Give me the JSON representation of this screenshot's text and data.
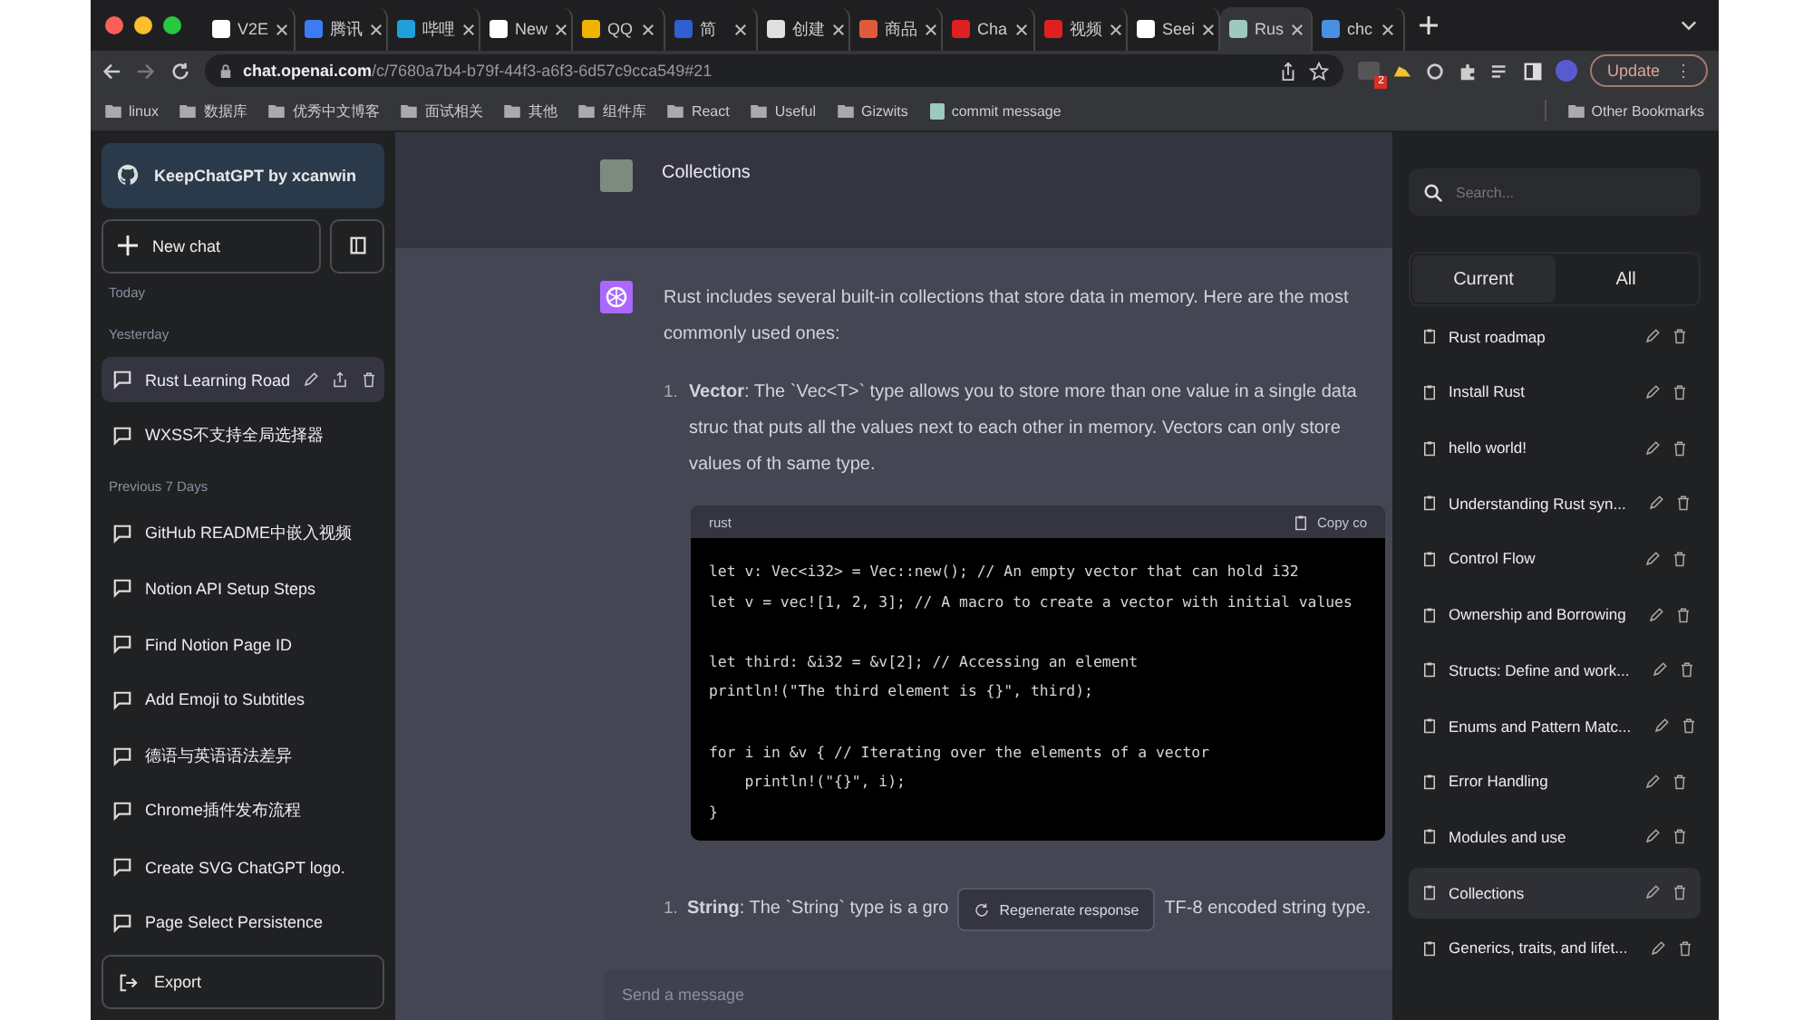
{
  "browser": {
    "tabs": [
      {
        "title": "V2E",
        "color": "#ffffff",
        "selected": false
      },
      {
        "title": "腾讯",
        "color": "#3b7cf5",
        "selected": false
      },
      {
        "title": "哔哩",
        "color": "#20a0d8",
        "selected": false
      },
      {
        "title": "New",
        "color": "#ffffff",
        "selected": false
      },
      {
        "title": "QQ",
        "color": "#f0b400",
        "selected": false
      },
      {
        "title": "简",
        "color": "#2f5fd0",
        "selected": false
      },
      {
        "title": "创建",
        "color": "#e0e0e0",
        "selected": false
      },
      {
        "title": "商品",
        "color": "#e05a3a",
        "selected": false
      },
      {
        "title": "Cha",
        "color": "#e02020",
        "selected": false
      },
      {
        "title": "视频",
        "color": "#e02020",
        "selected": false
      },
      {
        "title": "Seei",
        "color": "#ffffff",
        "selected": false
      },
      {
        "title": "Rus",
        "color": "#9fc9bc",
        "selected": true
      },
      {
        "title": "chc",
        "color": "#4a90e2",
        "selected": false
      }
    ],
    "url_host": "chat.openai.com",
    "url_path": "/c/7680a7b4-b79f-44f3-a6f3-6d57c9cca549#21",
    "extension_badge": "2",
    "update_button": "Update",
    "menu_glyph": "⋮",
    "bookmarks": [
      "linux",
      "数据库",
      "优秀中文博客",
      "面试相关",
      "其他",
      "组件库",
      "React",
      "Useful",
      "Gizwits"
    ],
    "bookmark_page": "commit message",
    "other_bookmarks": "Other Bookmarks"
  },
  "sidebar": {
    "banner": "KeepChatGPT by xcanwin",
    "new_chat": "New chat",
    "groups": [
      {
        "label": "Today"
      },
      {
        "label": "Yesterday",
        "items": [
          {
            "title": "Rust Learning Road",
            "selected": true
          },
          {
            "title": "WXSS不支持全局选择器",
            "selected": false
          }
        ]
      },
      {
        "label": "Previous 7 Days",
        "items": [
          {
            "title": "GitHub README中嵌入视频",
            "selected": false
          },
          {
            "title": "Notion API Setup Steps",
            "selected": false
          },
          {
            "title": "Find Notion Page ID",
            "selected": false
          },
          {
            "title": "Add Emoji to Subtitles",
            "selected": false
          },
          {
            "title": "德语与英语语法差异",
            "selected": false
          },
          {
            "title": "Chrome插件发布流程",
            "selected": false
          },
          {
            "title": "Create SVG ChatGPT logo.",
            "selected": false
          },
          {
            "title": "Page Select Persistence",
            "selected": false
          }
        ]
      }
    ],
    "export": "Export"
  },
  "chat": {
    "user_message": "Collections",
    "intro": "Rust includes several built-in collections that store data in memory. Here are the most commonly used ones:",
    "item_number": "1.",
    "item_text": "**Vector**: The `Vec<T>` type allows you to store more than one value in a single data struc that puts all the values next to each other in memory. Vectors can only store values of th same type.",
    "code": {
      "language": "rust",
      "copy": "Copy co",
      "blocks": [
        [
          "let v: Vec<i32> = Vec::new(); // An empty vector that can hold i32",
          "let v = vec![1, 2, 3]; // A macro to create a vector with initial values"
        ],
        [
          "let third: &i32 = &v[2]; // Accessing an element",
          "println!(\"The third element is {}\", third);"
        ],
        [
          "for i in &v { // Iterating over the elements of a vector",
          "    println!(\"{}\", i);",
          "}"
        ]
      ]
    },
    "item2_number": "1.",
    "item2_start": "**String**: The `String` type is a gro",
    "item2_end": "TF-8 encoded string type.",
    "regenerate": "Regenerate response",
    "input": {
      "placeholder": "Send a message"
    }
  },
  "panel": {
    "search": {
      "placeholder": "Search..."
    },
    "tabs": [
      {
        "label": "Current",
        "selected": true
      },
      {
        "label": "All",
        "selected": false
      }
    ],
    "items": [
      {
        "title": "Rust roadmap",
        "selected": false
      },
      {
        "title": "Install Rust",
        "selected": false
      },
      {
        "title": "hello world!",
        "selected": false
      },
      {
        "title": "Understanding Rust syn...",
        "selected": false
      },
      {
        "title": "Control Flow",
        "selected": false
      },
      {
        "title": "Ownership and Borrowing",
        "selected": false
      },
      {
        "title": "Structs: Define and work...",
        "selected": false
      },
      {
        "title": "Enums and Pattern Matc...",
        "selected": false
      },
      {
        "title": "Error Handling",
        "selected": false
      },
      {
        "title": "Modules and use",
        "selected": false
      },
      {
        "title": "Collections",
        "selected": true
      },
      {
        "title": "Generics, traits, and lifet...",
        "selected": false
      }
    ]
  }
}
